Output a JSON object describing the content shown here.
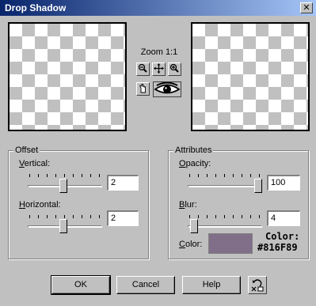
{
  "window": {
    "title": "Drop Shadow",
    "close_label": "✕"
  },
  "preview": {
    "zoom_label": "Zoom 1:1"
  },
  "offset": {
    "group_label": "Offset",
    "vertical": {
      "accel": "V",
      "label_rest": "ertical:",
      "value": "2",
      "slider_fraction": 0.48
    },
    "horizontal": {
      "accel": "H",
      "label_rest": "orizontal:",
      "value": "2",
      "slider_fraction": 0.48
    }
  },
  "attributes": {
    "group_label": "Attributes",
    "opacity": {
      "accel": "O",
      "label_rest": "pacity:",
      "value": "100",
      "slider_fraction": 1.0
    },
    "blur": {
      "accel": "B",
      "label_rest": "lur:",
      "value": "4",
      "slider_fraction": 0.03
    },
    "color": {
      "accel": "C",
      "label_rest": "olor:",
      "hex": "#816F89",
      "caption_line1": "Color:",
      "caption_line2": "#816F89"
    }
  },
  "buttons": {
    "ok": "OK",
    "cancel": "Cancel",
    "help": "Help"
  },
  "icons": {
    "zoom_out": "zoom-out-icon",
    "pan": "pan-icon",
    "zoom_in": "zoom-in-icon",
    "hand": "hand-icon",
    "eye": "eye-icon",
    "reset": "reset-icon"
  }
}
